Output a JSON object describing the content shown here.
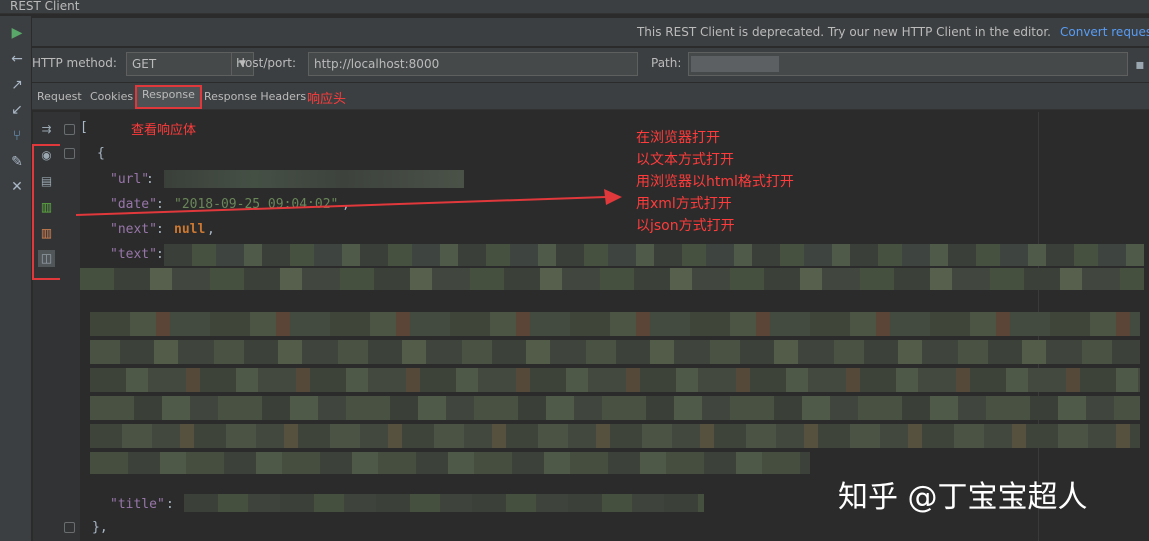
{
  "window": {
    "title": "REST Client"
  },
  "notice": {
    "message": "This REST Client is deprecated. Try our new HTTP Client in the editor.",
    "link": "Convert reques"
  },
  "form": {
    "method_label": "HTTP method:",
    "method_value": "GET",
    "host_label": "Host/port:",
    "host_value": "http://localhost:8000",
    "path_label": "Path:"
  },
  "tabs": [
    {
      "label": "Request"
    },
    {
      "label": "Cookies"
    },
    {
      "label": "Response",
      "active": true
    },
    {
      "label": "Response Headers"
    }
  ],
  "annotations": {
    "response_headers": "响应头",
    "view_body": "查看响应体",
    "open_modes": [
      "在浏览器打开",
      "以文本方式打开",
      "用浏览器以html格式打开",
      "用xml方式打开",
      "以json方式打开"
    ]
  },
  "code": {
    "open_bracket": "[",
    "open_brace": "{",
    "url_key": "\"url\"",
    "date_key": "\"date\"",
    "date_value": "\"2018-09-25 09:04:02\"",
    "next_key": "\"next\"",
    "next_value": "null",
    "text_key": "\"text\"",
    "title_key": "\"title\"",
    "colon": ":",
    "comma": ",",
    "close_brace": "},"
  },
  "left_toolbar_icons": [
    "run-icon",
    "back-arrow-icon",
    "export-icon",
    "import-icon",
    "branch-icon",
    "wrench-icon",
    "close-icon"
  ],
  "viewer_icons": [
    "globe-icon",
    "text-file-icon",
    "html-file-icon",
    "xml-file-icon",
    "json-file-icon"
  ],
  "watermark": "知乎 @丁宝宝超人",
  "colors": {
    "annotation": "#ff3b3b",
    "link": "#589df6",
    "keyword": "#cc7832",
    "string": "#6a8759",
    "key": "#9876aa"
  }
}
